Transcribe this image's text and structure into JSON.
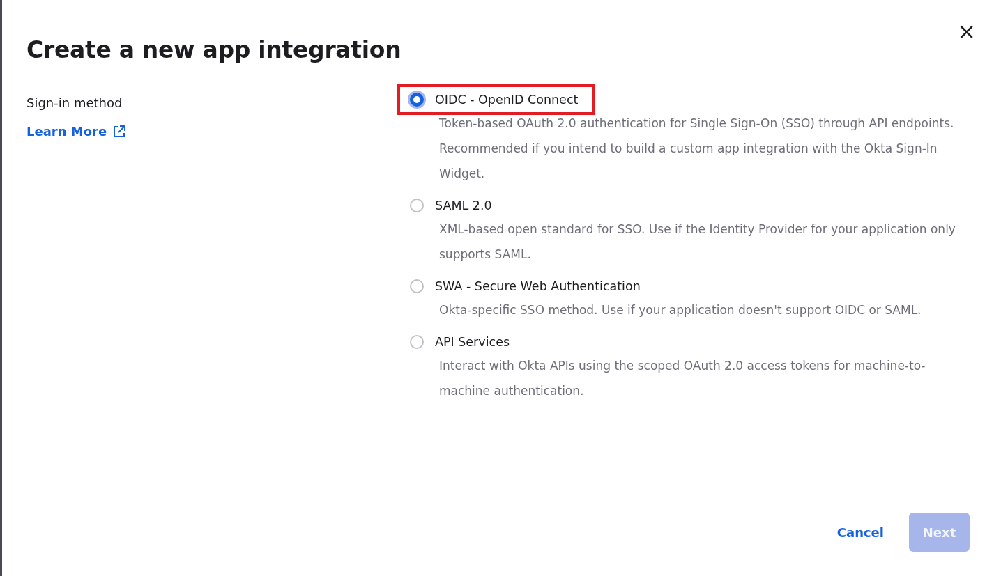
{
  "dialog": {
    "title": "Create a new app integration",
    "close_label": "×"
  },
  "sign_in_method": {
    "label": "Sign-in method",
    "link": "Learn More"
  },
  "options": [
    {
      "label": "OIDC - OpenID Connect",
      "description": "Token-based OAuth 2.0 authentication for Single Sign-On (SSO) through API endpoints. Recommended if you intend to build a custom app integration with the Okta Sign-In Widget.",
      "selected": true,
      "highlighted": true
    },
    {
      "label": "SAML 2.0",
      "description": "XML-based open standard for SSO. Use if the Identity Provider for your application only supports SAML.",
      "selected": false,
      "highlighted": false
    },
    {
      "label": "SWA - Secure Web Authentication",
      "description": "Okta-specific SSO method. Use if your application doesn't support OIDC or SAML.",
      "selected": false,
      "highlighted": false
    },
    {
      "label": "API Services",
      "description": "Interact with Okta APIs using the scoped OAuth 2.0 access tokens for machine-to-machine authentication.",
      "selected": false,
      "highlighted": false
    }
  ],
  "buttons": [
    {
      "label": "Cancel",
      "kind": "link",
      "disabled": false
    },
    {
      "label": "Next",
      "kind": "primary",
      "disabled": true
    }
  ]
}
